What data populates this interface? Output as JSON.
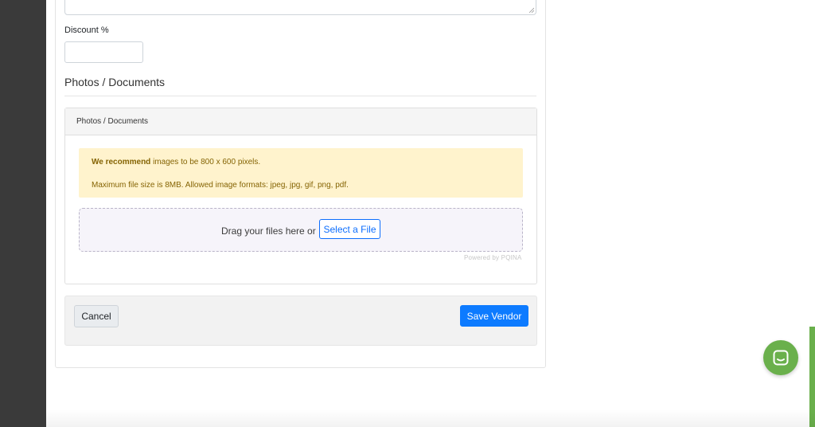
{
  "form": {
    "discount_label": "Discount %",
    "discount_value": "",
    "section_title": "Photos / Documents"
  },
  "panel": {
    "header": "Photos / Documents",
    "alert": {
      "bold": "We recommend",
      "line1_rest": " images to be 800 x 600 pixels.",
      "line2": "Maximum file size is 8MB. Allowed image formats: jpeg, jpg, gif, png, pdf."
    },
    "dropzone": {
      "text": "Drag your files here or",
      "button": "Select a File",
      "powered": "Powered by PQINA"
    }
  },
  "footer": {
    "cancel": "Cancel",
    "save": "Save Vendor"
  },
  "chat": {
    "icon": "chat-icon"
  },
  "colors": {
    "primary": "#0d7bff",
    "alert_bg": "#fff3cd",
    "alert_text": "#856404",
    "chat": "#6ab04c",
    "sidebar": "#3a3a3a"
  }
}
